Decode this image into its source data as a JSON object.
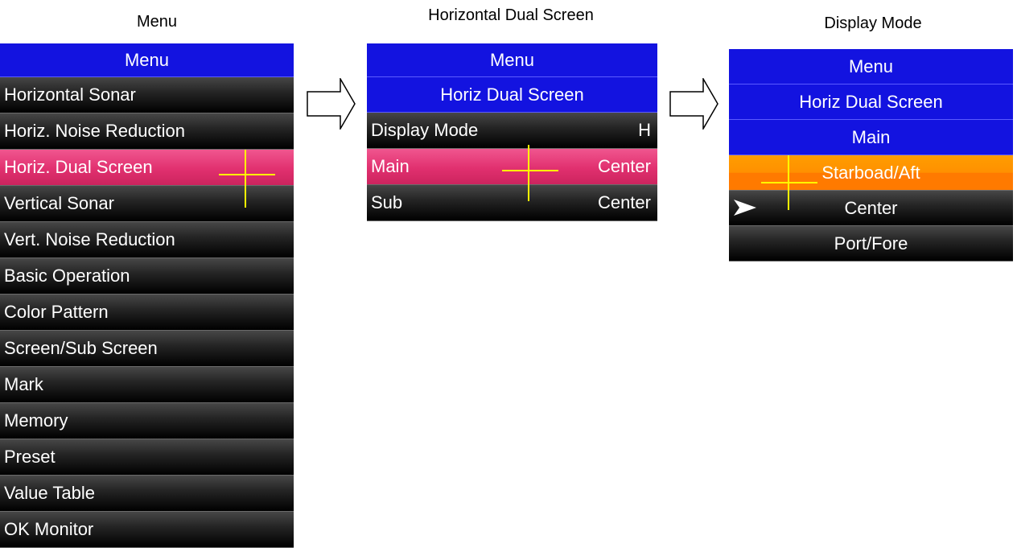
{
  "captions": {
    "menu": "Menu",
    "horizontal_dual_screen": "Horizontal Dual Screen",
    "display_mode": "Display Mode"
  },
  "panel1": {
    "title": "Menu",
    "items": [
      "Horizontal Sonar",
      "Horiz. Noise Reduction",
      "Horiz. Dual Screen",
      "Vertical Sonar",
      "Vert. Noise Reduction",
      "Basic Operation",
      "Color Pattern",
      "Screen/Sub Screen",
      "Mark",
      "Memory",
      "Preset",
      "Value Table",
      "OK Monitor"
    ],
    "selected_index": 2
  },
  "panel2": {
    "title": "Menu",
    "subtitle": "Horiz Dual Screen",
    "items": [
      {
        "label": "Display Mode",
        "value": "H"
      },
      {
        "label": "Main",
        "value": "Center"
      },
      {
        "label": "Sub",
        "value": "Center"
      }
    ],
    "selected_index": 1
  },
  "panel3": {
    "title": "Menu",
    "subtitle": "Horiz Dual Screen",
    "subsubtitle": "Main",
    "options": [
      "Starboad/Aft",
      "Center",
      "Port/Fore"
    ],
    "highlighted_index": 0,
    "current_index": 1
  },
  "colors": {
    "header_blue": "#1313e0",
    "selected_pink": "#e1306f",
    "highlight_orange": "#ff9000",
    "cursor_yellow": "#ffff00"
  },
  "icons": {
    "flow_arrow": "right-arrow-outline-icon",
    "cursor": "crosshair-icon",
    "current_marker": "pointer-arrow-icon"
  }
}
